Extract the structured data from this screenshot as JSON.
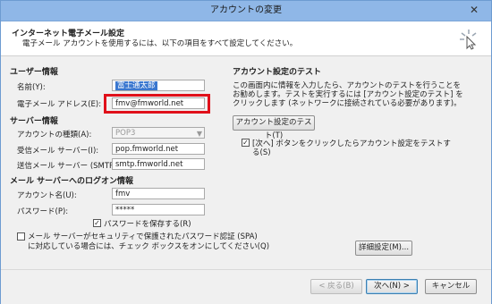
{
  "window": {
    "title": "アカウントの変更",
    "close": "✕"
  },
  "header": {
    "title": "インターネット電子メール設定",
    "subtitle": "電子メール アカウントを使用するには、以下の項目をすべて設定してください。"
  },
  "user_section": {
    "heading": "ユーザー情報",
    "name_label": "名前(Y):",
    "name_value": "富士通太郎",
    "email_label": "電子メール アドレス(E):",
    "email_value": "fmv@fmworld.net"
  },
  "server_section": {
    "heading": "サーバー情報",
    "type_label": "アカウントの種類(A):",
    "type_value": "POP3",
    "incoming_label": "受信メール サーバー(I):",
    "incoming_value": "pop.fmworld.net",
    "outgoing_label": "送信メール サーバー (SMTP)(O):",
    "outgoing_value": "smtp.fmworld.net"
  },
  "logon_section": {
    "heading": "メール サーバーへのログオン情報",
    "account_label": "アカウント名(U):",
    "account_value": "fmv",
    "password_label": "パスワード(P):",
    "password_value": "*****",
    "save_password_label": "パスワードを保存する(R)",
    "spa_label_line1": "メール サーバーがセキュリティで保護されたパスワード認証 (SPA)",
    "spa_label_line2": "に対応している場合には、チェック ボックスをオンにしてください(Q)"
  },
  "test_section": {
    "heading": "アカウント設定のテスト",
    "desc_line1": "この画面内に情報を入力したら、アカウントのテストを行うことを",
    "desc_line2": "お勧めします。テストを実行するには [アカウント設定のテスト] を",
    "desc_line3": "クリックします (ネットワークに接続されている必要があります)。",
    "test_button": "アカウント設定のテスト(T)",
    "auto_test_line1": "[次へ] ボタンをクリックしたらアカウント設定をテストす",
    "auto_test_line2": "る(S)"
  },
  "more_settings_button": "詳細設定(M)...",
  "footer": {
    "back": "< 戻る(B)",
    "next": "次へ(N) >",
    "cancel": "キャンセル"
  },
  "check_mark": "✓"
}
